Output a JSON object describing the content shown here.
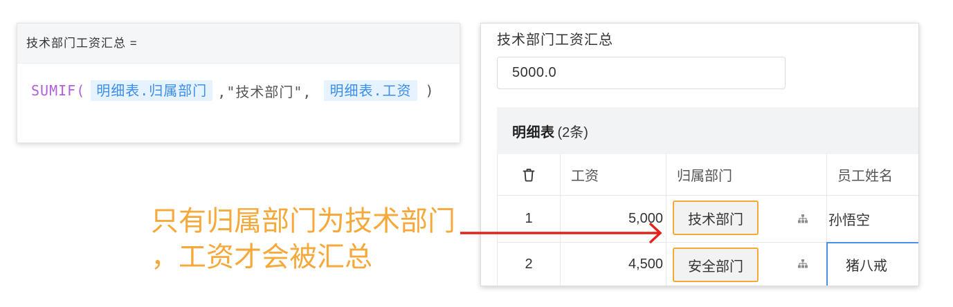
{
  "formula_card": {
    "title": "技术部门工资汇总 =",
    "formula": {
      "function": "SUMIF(",
      "range_field": "明细表.归属部门",
      "criteria": ",\"技术部门\",",
      "sum_field": "明细表.工资",
      "close": ")"
    }
  },
  "form": {
    "field_label": "技术部门工资汇总",
    "field_value": "5000.0",
    "subtable": {
      "title": "明细表",
      "count": "(2条)",
      "columns": [
        "工资",
        "归属部门",
        "员工姓名"
      ],
      "rows": [
        {
          "index": "1",
          "salary": "5,000",
          "department": "技术部门",
          "employee": "孙悟空"
        },
        {
          "index": "2",
          "salary": "4,500",
          "department": "安全部门",
          "employee": "猪八戒"
        }
      ]
    }
  },
  "annotation": {
    "line1": "只有归属部门为技术部门",
    "line2": "，工资才会被汇总"
  },
  "icons": {
    "subtable_delete": "trash-icon",
    "department_picker": "org-chart-icon",
    "callout_arrow": "arrow-right-icon"
  },
  "colors": {
    "formula_function": "#b15fd8",
    "field_tag_bg": "#e7f2ff",
    "field_tag_text": "#3a8ef0",
    "dept_tag_border": "#f5a836",
    "focus_border": "#4a8fe6",
    "annotation_text": "#f4a93a",
    "arrow": "#e3231b"
  }
}
